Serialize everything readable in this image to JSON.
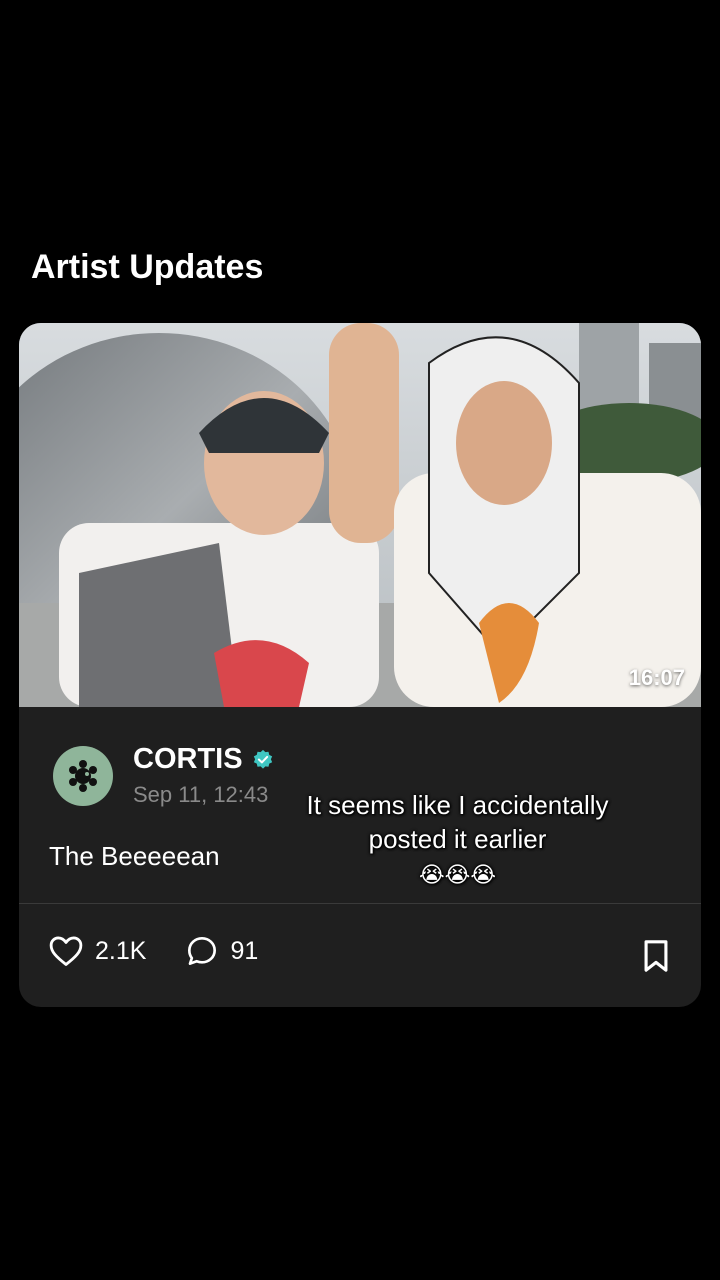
{
  "section": {
    "title": "Artist Updates"
  },
  "post": {
    "media": {
      "duration": "16:07"
    },
    "author": {
      "name": "CORTIS",
      "verified": true,
      "avatar_icon": "cortis-logo-icon"
    },
    "time": "Sep 11, 12:43",
    "text": "The Beeeeean",
    "likes": "2.1K",
    "comments": "91"
  },
  "caption": {
    "line1": "It seems like I accidentally",
    "line2": "posted it earlier",
    "emojis": "😭😭😭"
  },
  "colors": {
    "background": "#000000",
    "card": "#1f1f1f",
    "verified_badge": "#3fc6c2",
    "avatar_bg": "#8fb59a"
  }
}
